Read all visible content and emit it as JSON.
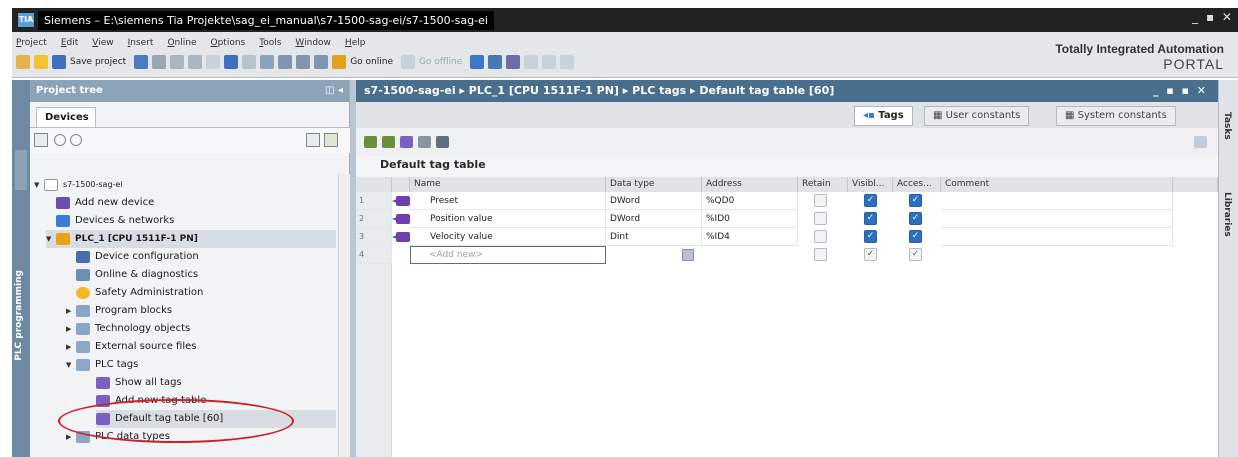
{
  "window": {
    "app_icon": "TIA",
    "title": "Siemens – E:\\siemens Tia Projekte\\sag_ei_manual\\s7-1500-sag-ei/s7-1500-sag-ei",
    "controls": "_ ▪ ✕"
  },
  "menu": [
    "Project",
    "Edit",
    "View",
    "Insert",
    "Online",
    "Options",
    "Tools",
    "Window",
    "Help"
  ],
  "toolbar": {
    "save_label": "Save project",
    "go_online": "Go online",
    "go_offline": "Go offline"
  },
  "brand": {
    "line1": "Totally Integrated Automation",
    "line2": "PORTAL"
  },
  "left_strip": {
    "label": "PLC programming"
  },
  "project_tree": {
    "header": "Project tree",
    "header_controls": "◫ ◂",
    "devices_tab": "Devices",
    "items": [
      {
        "label": "s7-1500-sag-ei",
        "icon": "project-icon",
        "color": "#ffffff"
      },
      {
        "label": "Add new device",
        "icon": "add-device-icon",
        "color": "#6a4fb3"
      },
      {
        "label": "Devices & networks",
        "icon": "network-icon",
        "color": "#3b7bd4"
      },
      {
        "label": "PLC_1 [CPU 1511F-1 PN]",
        "icon": "plc-icon",
        "color": "#e8a21c"
      },
      {
        "label": "Device configuration",
        "icon": "device-config-icon",
        "color": "#4a6fa8"
      },
      {
        "label": "Online & diagnostics",
        "icon": "diagnostics-icon",
        "color": "#6d8fb4"
      },
      {
        "label": "Safety Administration",
        "icon": "safety-icon",
        "color": "#f2b824"
      },
      {
        "label": "Program blocks",
        "icon": "folder-icon",
        "color": "#8aa7c6"
      },
      {
        "label": "Technology objects",
        "icon": "folder-icon",
        "color": "#8aa7c6"
      },
      {
        "label": "External source files",
        "icon": "folder-icon",
        "color": "#8aa7c6"
      },
      {
        "label": "PLC tags",
        "icon": "folder-icon",
        "color": "#8aa7c6"
      },
      {
        "label": "Show all tags",
        "icon": "tags-icon",
        "color": "#7d5fc2"
      },
      {
        "label": "Add new tag table",
        "icon": "add-tag-table-icon",
        "color": "#7d5fc2"
      },
      {
        "label": "Default tag table [60]",
        "icon": "tag-table-icon",
        "color": "#7d5fc2"
      },
      {
        "label": "PLC data types",
        "icon": "folder-icon",
        "color": "#8aa7c6"
      }
    ]
  },
  "editor": {
    "breadcrumb": "s7-1500-sag-ei  ▸  PLC_1 [CPU 1511F-1 PN]  ▸  PLC tags  ▸  Default tag table [60]",
    "controls": "_ ▪ ▪ ✕",
    "tabs": [
      "Tags",
      "User constants",
      "System constants"
    ],
    "table_title": "Default tag table",
    "columns": [
      "Name",
      "Data type",
      "Address",
      "Retain",
      "Visibl...",
      "Acces...",
      "Comment"
    ],
    "rows": [
      {
        "num": "1",
        "name": "Preset",
        "type": "DWord",
        "address": "%QD0",
        "retain": false,
        "visible": true,
        "access": true
      },
      {
        "num": "2",
        "name": "Position value",
        "type": "DWord",
        "address": "%ID0",
        "retain": false,
        "visible": true,
        "access": true
      },
      {
        "num": "3",
        "name": "Velocity value",
        "type": "Dint",
        "address": "%ID4",
        "retain": false,
        "visible": true,
        "access": true
      }
    ],
    "new_row": {
      "num": "4",
      "placeholder": "<Add new>"
    }
  },
  "right_strip": {
    "tabs": [
      "Tasks",
      "Libraries"
    ]
  },
  "colors": {
    "accent_header": "#4a6f8d",
    "highlight_ring": "#c8242b",
    "tag_icon": "#6f3fb0"
  }
}
